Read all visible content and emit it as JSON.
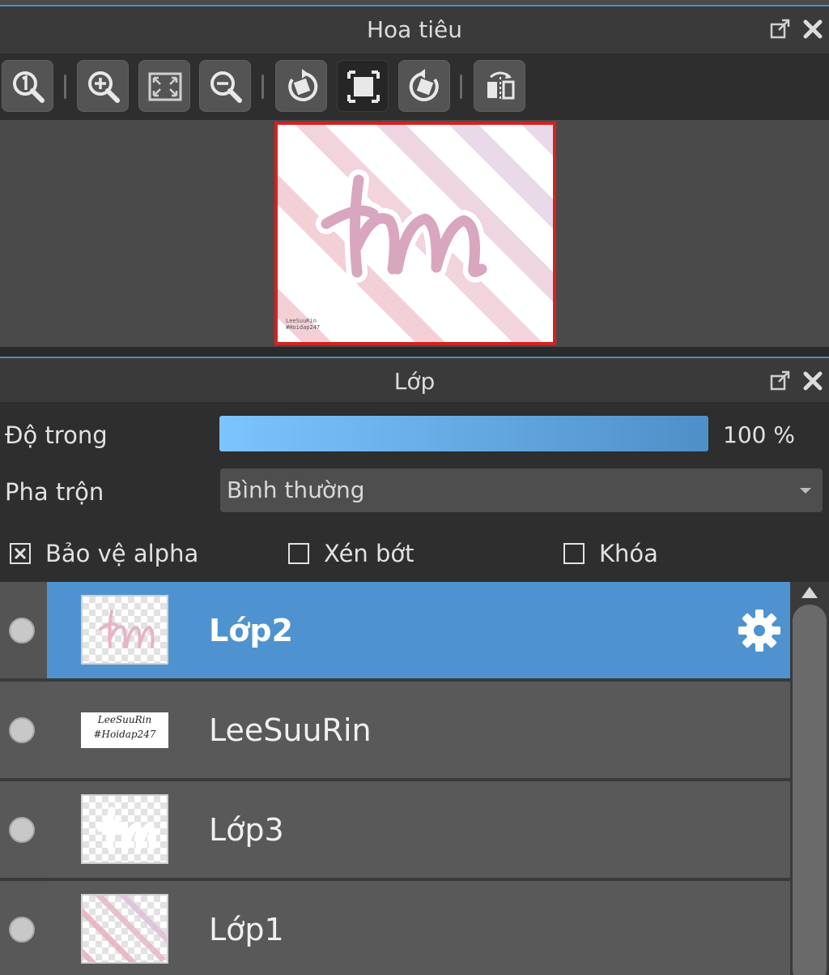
{
  "navigator_panel": {
    "title": "Hoa tiêu"
  },
  "toolbar": {
    "buttons": [
      {
        "name": "zoom-actual-size",
        "icon": "zoom-1-icon"
      },
      {
        "name": "zoom-in",
        "icon": "zoom-in-icon"
      },
      {
        "name": "fit-to-window",
        "icon": "fit-screen-icon"
      },
      {
        "name": "zoom-out",
        "icon": "zoom-out-icon"
      },
      {
        "name": "rotate-left",
        "icon": "rotate-left-icon"
      },
      {
        "name": "reset-view",
        "icon": "reset-view-icon",
        "active": true
      },
      {
        "name": "rotate-right",
        "icon": "rotate-right-icon"
      },
      {
        "name": "flip-horizontal",
        "icon": "flip-horizontal-icon"
      }
    ]
  },
  "preview": {
    "watermark_line1": "LeeSuuRin",
    "watermark_line2": "#Hoidap247"
  },
  "layer_panel": {
    "title": "Lớp",
    "opacity_label": "Độ trong",
    "opacity_value": "100 %",
    "opacity_fraction": 1.0,
    "blend_label": "Pha trộn",
    "blend_value": "Bình thường",
    "protect_alpha_label": "Bảo vệ alpha",
    "protect_alpha_checked": true,
    "clipping_label": "Xén bớt",
    "clipping_checked": false,
    "lock_label": "Khóa",
    "lock_checked": false
  },
  "layers": [
    {
      "name": "Lớp2",
      "selected": true,
      "thumb_text": "hn"
    },
    {
      "name": "LeeSuuRin",
      "selected": false,
      "thumb_line1": "LeeSuuRin",
      "thumb_line2": "#Hoidap247"
    },
    {
      "name": "Lớp3",
      "selected": false
    },
    {
      "name": "Lớp1",
      "selected": false
    }
  ],
  "colors": {
    "accent_blue": "#4e93cf",
    "preview_border": "#d62020",
    "stripe_pink": "#f2c7cf",
    "stripe_lavender": "#e6d3e6",
    "letter_pink": "#d9a6bf"
  }
}
